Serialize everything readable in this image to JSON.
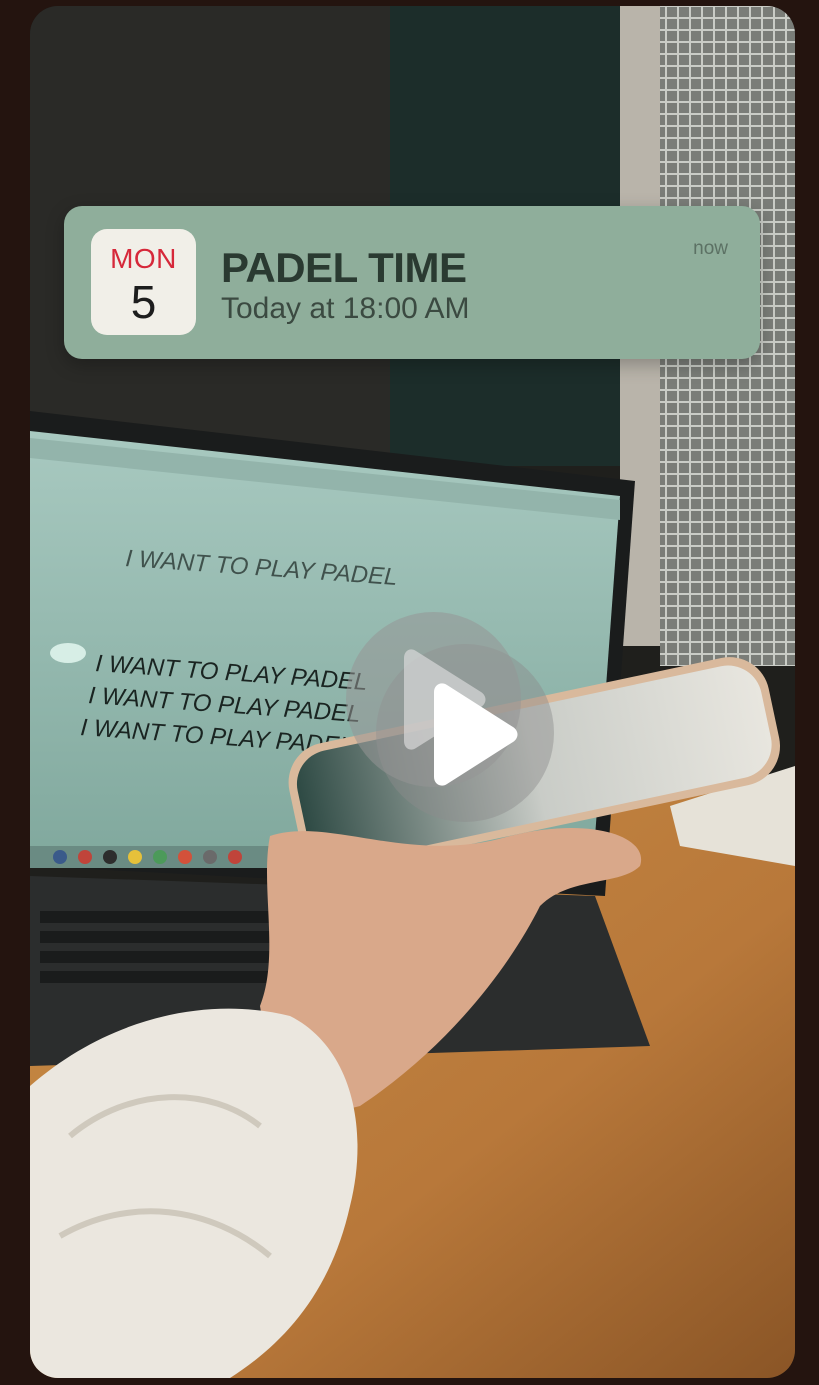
{
  "notification": {
    "calendar_month": "MON",
    "calendar_day": "5",
    "title": "PADEL TIME",
    "subtitle": "Today at 18:00 AM",
    "time": "now"
  },
  "laptop_screen_text": {
    "header_line": "I WANT TO PLAY PADEL",
    "lines": [
      "I WANT TO PLAY PADEL",
      "I WANT TO PLAY PADEL",
      "I WANT TO PLAY PADEL"
    ]
  },
  "video": {
    "play_icon": "play-icon"
  },
  "colors": {
    "notification_bg": "#8fae9b",
    "calendar_month": "#d6283a",
    "page_bg": "#24140f"
  }
}
